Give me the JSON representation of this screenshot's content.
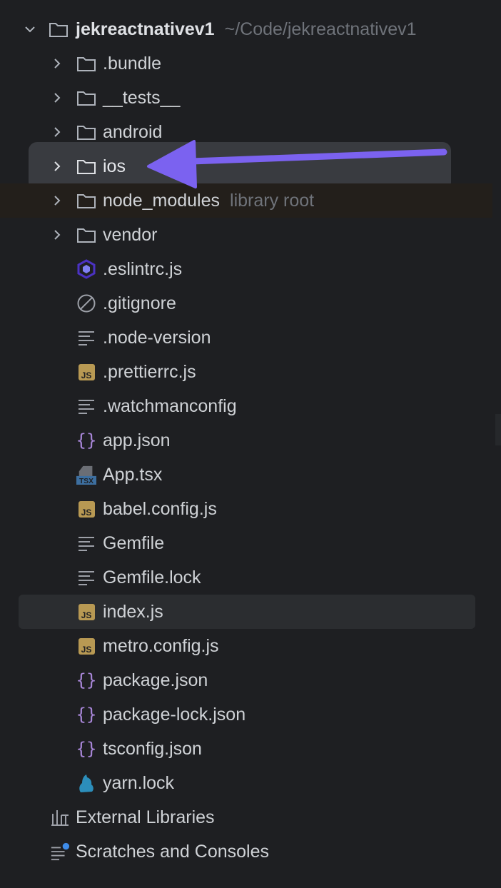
{
  "root": {
    "name": "jekreactnativev1",
    "path": "~/Code/jekreactnativev1"
  },
  "folders": [
    {
      "label": ".bundle"
    },
    {
      "label": "__tests__"
    },
    {
      "label": "android"
    },
    {
      "label": "ios"
    },
    {
      "label": "node_modules",
      "hint": "library root"
    },
    {
      "label": "vendor"
    }
  ],
  "files": [
    {
      "label": ".eslintrc.js",
      "icon": "eslint-icon"
    },
    {
      "label": ".gitignore",
      "icon": "ignore-icon"
    },
    {
      "label": ".node-version",
      "icon": "text-file-icon"
    },
    {
      "label": ".prettierrc.js",
      "icon": "js-icon",
      "badge": "JS"
    },
    {
      "label": ".watchmanconfig",
      "icon": "text-file-icon"
    },
    {
      "label": "app.json",
      "icon": "json-icon",
      "glyph": "{}"
    },
    {
      "label": "App.tsx",
      "icon": "tsx-icon",
      "badge": "TSX"
    },
    {
      "label": "babel.config.js",
      "icon": "js-icon",
      "badge": "JS"
    },
    {
      "label": "Gemfile",
      "icon": "text-file-icon"
    },
    {
      "label": "Gemfile.lock",
      "icon": "text-file-icon"
    },
    {
      "label": "index.js",
      "icon": "js-icon",
      "badge": "JS"
    },
    {
      "label": "metro.config.js",
      "icon": "js-icon",
      "badge": "JS"
    },
    {
      "label": "package.json",
      "icon": "json-icon",
      "glyph": "{}"
    },
    {
      "label": "package-lock.json",
      "icon": "json-icon",
      "glyph": "{}"
    },
    {
      "label": "tsconfig.json",
      "icon": "json-icon",
      "glyph": "{}"
    },
    {
      "label": "yarn.lock",
      "icon": "yarn-icon"
    }
  ],
  "external_libraries": "External Libraries",
  "scratches": "Scratches and Consoles",
  "colors": {
    "background": "#1e1f22",
    "selected_row": "#2b2d30",
    "highlight_box": "#393b40",
    "arrow": "#7b62f0",
    "js_badge": "#b89953",
    "json_brace": "#a886d8",
    "eslint": "#4b32c3",
    "yarn": "#2c8ebb",
    "muted_text": "#6f737a"
  }
}
